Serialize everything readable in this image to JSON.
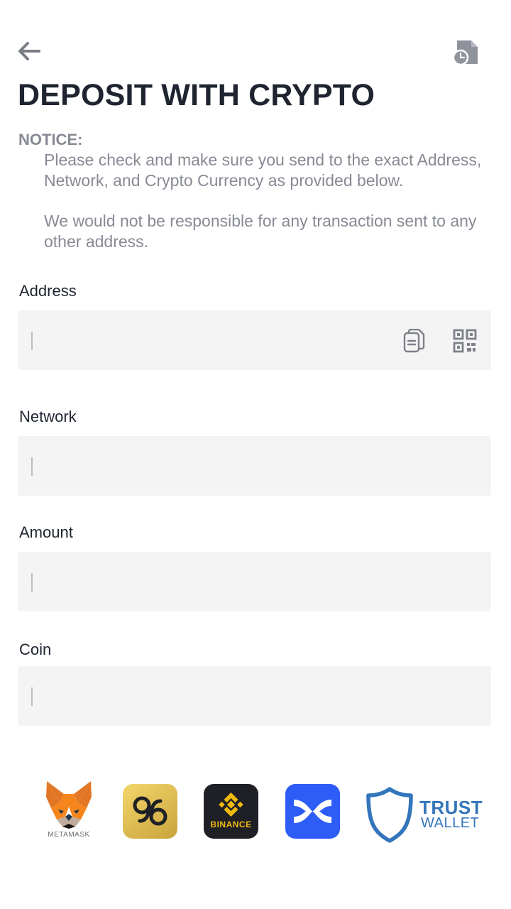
{
  "header": {
    "title": "DEPOSIT WITH CRYPTO",
    "back_icon": "arrow-left-icon",
    "history_icon": "document-history-icon"
  },
  "notice": {
    "title": "NOTICE:",
    "paragraph1": "Please check and make sure you send to the exact Address, Network, and Crypto Currency as provided below.",
    "paragraph2": "We would not be responsible for any transaction sent to any other address."
  },
  "form": {
    "address": {
      "label": "Address",
      "value": "",
      "copy_icon": "copy-icon",
      "qr_icon": "qr-code-icon"
    },
    "network": {
      "label": "Network",
      "value": ""
    },
    "amount": {
      "label": "Amount",
      "value": ""
    },
    "coin": {
      "label": "Coin",
      "value": ""
    }
  },
  "wallets": {
    "metamask_label": "METAMASK",
    "coin98_label": "98",
    "binance_label": "BINANCE",
    "trust_line1": "TRUST",
    "trust_line2": "WALLET"
  },
  "colors": {
    "title": "#1f2430",
    "notice": "#878a94",
    "field_bg": "#f4f4f4",
    "binance_yellow": "#f0b90b",
    "trust_blue": "#3375bb",
    "cross_blue": "#2d5cf6"
  }
}
